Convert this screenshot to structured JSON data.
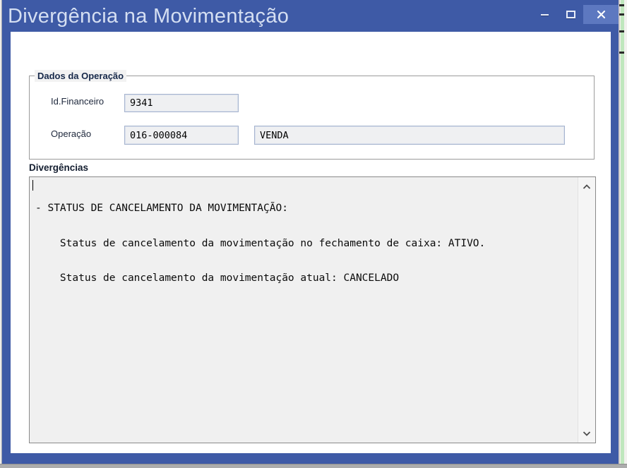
{
  "window": {
    "title": "Divergência na Movimentação",
    "titlebar_color": "#3e5aa6",
    "close_button_highlight_color": "#5d78c0"
  },
  "icons": {
    "minimize-icon": "–",
    "maximize-icon": "▢",
    "close-icon": "✕",
    "scroll-up-icon": "∧",
    "scroll-down-icon": "∨"
  },
  "operation_group": {
    "title": "Dados da Operação",
    "id_financeiro": {
      "label": "Id.Financeiro",
      "value": "9341"
    },
    "operacao": {
      "label": "Operação",
      "code": "016-000084",
      "description": "VENDA"
    }
  },
  "divergences": {
    "label": "Divergências",
    "lines": [
      "- STATUS DE CANCELAMENTO DA MOVIMENTAÇÃO:",
      "    Status de cancelamento da movimentação no fechamento de caixa: ATIVO.",
      "    Status de cancelamento da movimentação atual: CANCELADO"
    ]
  },
  "background": {
    "side_strip_green": "#bfe7bd",
    "bottom_bar_gray": "#acacac"
  }
}
